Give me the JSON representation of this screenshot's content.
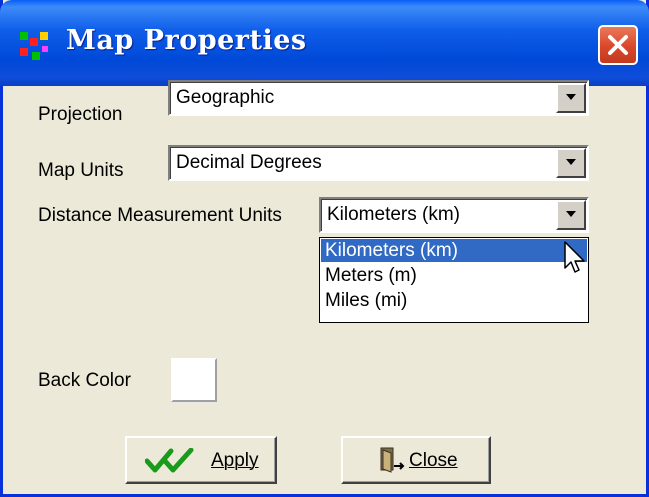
{
  "window": {
    "title": "Map Properties"
  },
  "projection": {
    "label": "Projection",
    "value": "Geographic"
  },
  "map_units": {
    "label": "Map Units",
    "value": "Decimal Degrees"
  },
  "distance_units": {
    "label": "Distance Measurement Units",
    "value": "Kilometers (km)",
    "options": [
      "Kilometers (km)",
      "Meters (m)",
      "Miles (mi)"
    ],
    "highlighted_option": "Kilometers (km)"
  },
  "back_color": {
    "label": "Back Color",
    "color": "#ffffff"
  },
  "buttons": {
    "apply": "Apply",
    "close": "Close"
  },
  "colors": {
    "titlebar": "#0054e3",
    "highlight": "#316ac5",
    "apply_check": "#1a9a1a"
  }
}
